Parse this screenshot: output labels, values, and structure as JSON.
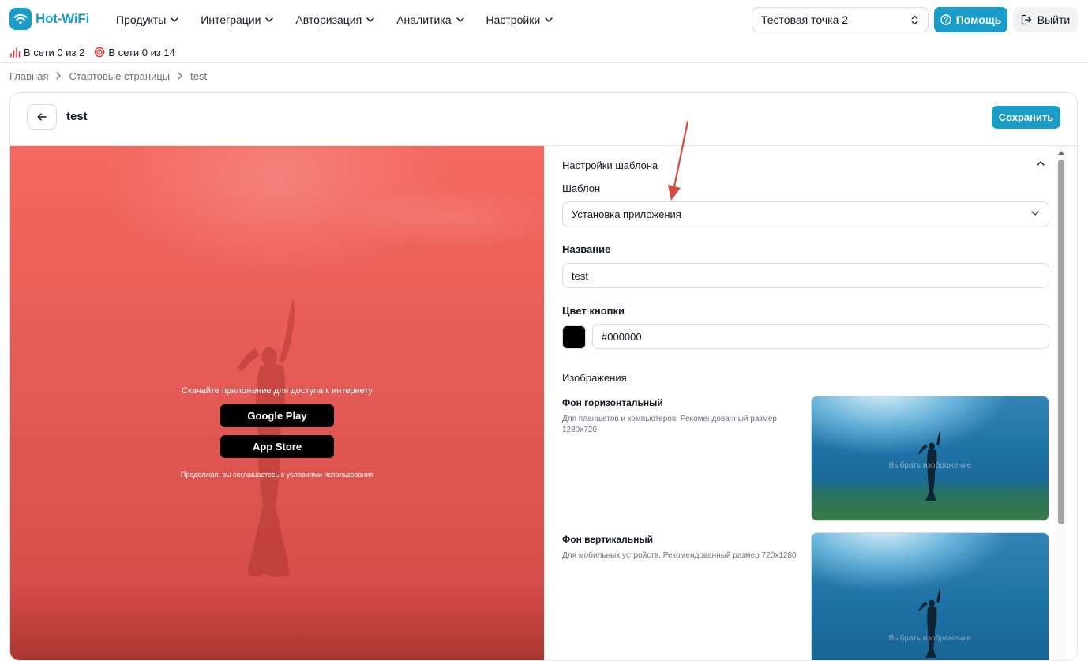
{
  "brand": {
    "name": "Hot-WiFi",
    "color": "#1a9cc8"
  },
  "nav": {
    "items": [
      {
        "label": "Продукты"
      },
      {
        "label": "Интеграции"
      },
      {
        "label": "Авторизация"
      },
      {
        "label": "Аналитика"
      },
      {
        "label": "Настройки"
      }
    ],
    "point_select": "Тестовая точка 2",
    "help_label": "Помощь",
    "logout_label": "Выйти"
  },
  "status": {
    "online_points": "В сети 0 из 2",
    "online_devices": "В сети 0 из 14"
  },
  "breadcrumb": [
    "Главная",
    "Стартовые страницы",
    "test"
  ],
  "page": {
    "title": "test",
    "save_label": "Сохранить"
  },
  "preview": {
    "heading": "Скачайте приложение для доступа к интернету",
    "google_play": "Google Play",
    "app_store": "App Store",
    "terms": "Продолжая, вы соглашаетесь с условиями использования",
    "bg_color": "#f06560"
  },
  "settings": {
    "section_title": "Настройки шаблона",
    "template_label": "Шаблон",
    "template_value": "Установка приложения",
    "name_label": "Название",
    "name_value": "test",
    "button_color_label": "Цвет кнопки",
    "button_color_value": "#000000",
    "images_label": "Изображения",
    "images": [
      {
        "title": "Фон горизонтальный",
        "description": "Для планшетов и компьютеров. Рекомендованный размер 1280x720",
        "pick_label": "Выбрать изображение"
      },
      {
        "title": "Фон вертикальный",
        "description": "Для мобильных устройств. Рекомендованный размер 720x1280",
        "pick_label": "Выбрать изображение"
      }
    ]
  },
  "annotation": {
    "color": "#d14b3f"
  }
}
